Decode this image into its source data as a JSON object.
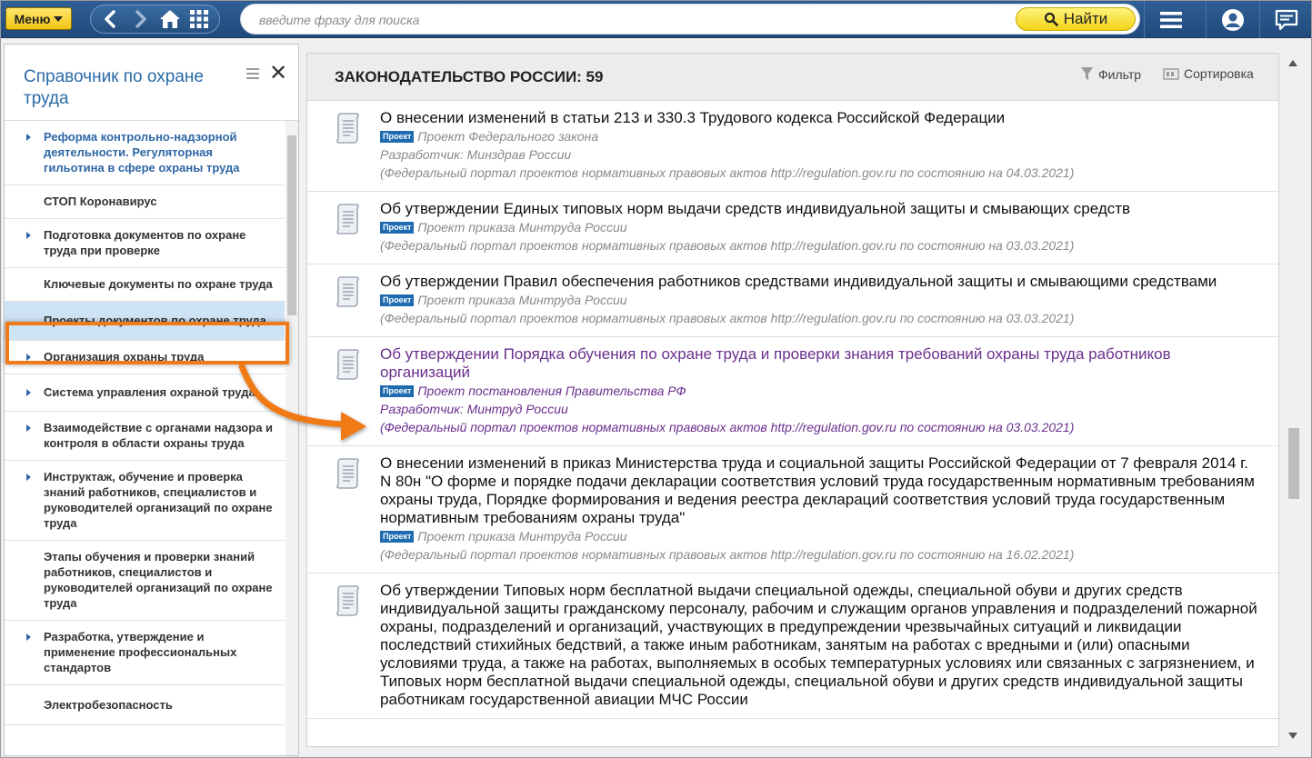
{
  "topbar": {
    "menu_label": "Меню",
    "search_placeholder": "введите фразу для поиска",
    "find_label": "Найти"
  },
  "sidebar": {
    "title": "Справочник по охране труда",
    "items": [
      {
        "label": "Реформа контрольно-надзорной деятельности. Регуляторная гильотина в сфере охраны труда",
        "arrow": true,
        "link": true
      },
      {
        "label": "СТОП Коронавирус",
        "arrow": false
      },
      {
        "label": "Подготовка документов по охране труда при проверке",
        "arrow": true
      },
      {
        "label": "Ключевые документы по охране труда",
        "arrow": false
      },
      {
        "label": "Проекты документов по охране труда",
        "arrow": false,
        "selected": true
      },
      {
        "label": "Организация охраны труда",
        "arrow": true
      },
      {
        "label": "Система управления охраной труда",
        "arrow": true
      },
      {
        "label": "Взаимодействие с органами надзора и контроля в области охраны труда",
        "arrow": true
      },
      {
        "label": "Инструктаж, обучение и проверка знаний работников, специалистов и руководителей организаций по охране труда",
        "arrow": true
      },
      {
        "label": "Этапы обучения и проверки знаний работников, специалистов и руководителей организаций по охране труда",
        "arrow": false
      },
      {
        "label": "Разработка, утверждение и применение профессиональных стандартов",
        "arrow": true
      },
      {
        "label": "Электробезопасность",
        "arrow": false
      }
    ]
  },
  "main": {
    "title": "ЗАКОНОДАТЕЛЬСТВО РОССИИ: 59",
    "filter_label": "Фильтр",
    "sort_label": "Сортировка",
    "badge": "Проект",
    "documents": [
      {
        "title": "О внесении изменений в статьи 213 и 330.3 Трудового кодекса Российской Федерации",
        "type": "Проект Федерального закона",
        "developer": "Разработчик: Минздрав России",
        "source": "(Федеральный портал проектов нормативных правовых актов http://regulation.gov.ru по состоянию на 04.03.2021)"
      },
      {
        "title": "Об утверждении Единых типовых норм выдачи средств индивидуальной защиты и смывающих средств",
        "type": "Проект приказа Минтруда России",
        "source": "(Федеральный портал проектов нормативных правовых актов http://regulation.gov.ru по состоянию на 03.03.2021)"
      },
      {
        "title": "Об утверждении Правил обеспечения работников средствами индивидуальной защиты и смывающими средствами",
        "type": "Проект приказа Минтруда России",
        "source": "(Федеральный портал проектов нормативных правовых актов http://regulation.gov.ru по состоянию на 03.03.2021)"
      },
      {
        "title": "Об утверждении Порядка обучения по охране труда и проверки знания требований охраны труда работников организаций",
        "type": "Проект постановления Правительства РФ",
        "developer": "Разработчик: Минтруд России",
        "source": "(Федеральный портал проектов нормативных правовых актов http://regulation.gov.ru по состоянию на 03.03.2021)",
        "visited": true
      },
      {
        "title": "О внесении изменений в приказ Министерства труда и социальной защиты Российской Федерации от 7 февраля 2014 г. N 80н \"О форме и порядке подачи декларации соответствия условий труда государственным нормативным требованиям охраны труда, Порядке формирования и ведения реестра деклараций соответствия условий труда государственным нормативным требованиям охраны труда\"",
        "type": "Проект приказа Минтруда России",
        "source": "(Федеральный портал проектов нормативных правовых актов http://regulation.gov.ru по состоянию на 16.02.2021)"
      },
      {
        "title": "Об утверждении Типовых норм бесплатной выдачи специальной одежды, специальной обуви и других средств индивидуальной защиты гражданскому персоналу, рабочим и служащим органов управления и подразделений пожарной охраны, подразделений и организаций, участвующих в предупреждении чрезвычайных ситуаций и ликвидации последствий стихийных бедствий, а также иным работникам, занятым на работах с вредными и (или) опасными условиями труда, а также на работах, выполняемых в особых температурных условиях или связанных с загрязнением, и Типовых норм бесплатной выдачи специальной одежды, специальной обуви и других средств индивидуальной защиты работникам государственной авиации МЧС России"
      }
    ]
  },
  "colors": {
    "accent": "#2f67a6",
    "highlight": "#f07a18",
    "visited": "#6b2f8e",
    "topbar": "#2a5788"
  },
  "icons": [
    "back-icon",
    "forward-icon",
    "home-icon",
    "grid-icon",
    "search-icon",
    "hamburger-icon",
    "user-icon",
    "message-icon",
    "filter-icon",
    "sort-icon",
    "document-icon",
    "close-icon"
  ]
}
